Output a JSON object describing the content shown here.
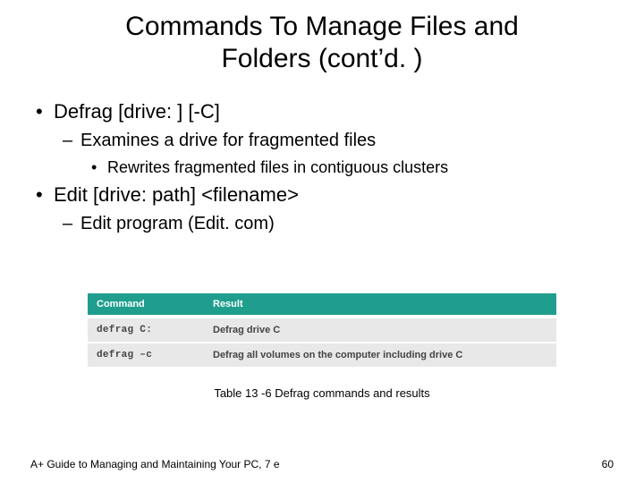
{
  "title_line1": "Commands To Manage Files and",
  "title_line2": "Folders (cont’d. )",
  "bullets": {
    "b1a": "Defrag [drive: ] [-C]",
    "b2a": "Examines a drive for fragmented files",
    "b3a": "Rewrites fragmented files in contiguous clusters",
    "b1b": "Edit [drive: path] <filename>",
    "b2b": "Edit program (Edit. com)"
  },
  "table": {
    "headers": {
      "cmd": "Command",
      "res": "Result"
    },
    "rows": [
      {
        "cmd": "defrag C:",
        "res": "Defrag drive C"
      },
      {
        "cmd": "defrag –c",
        "res": "Defrag all volumes on the computer including drive C"
      }
    ]
  },
  "caption": "Table 13 -6 Defrag commands and results",
  "footer_left": "A+ Guide to Managing and Maintaining Your PC, 7 e",
  "footer_right": "60"
}
